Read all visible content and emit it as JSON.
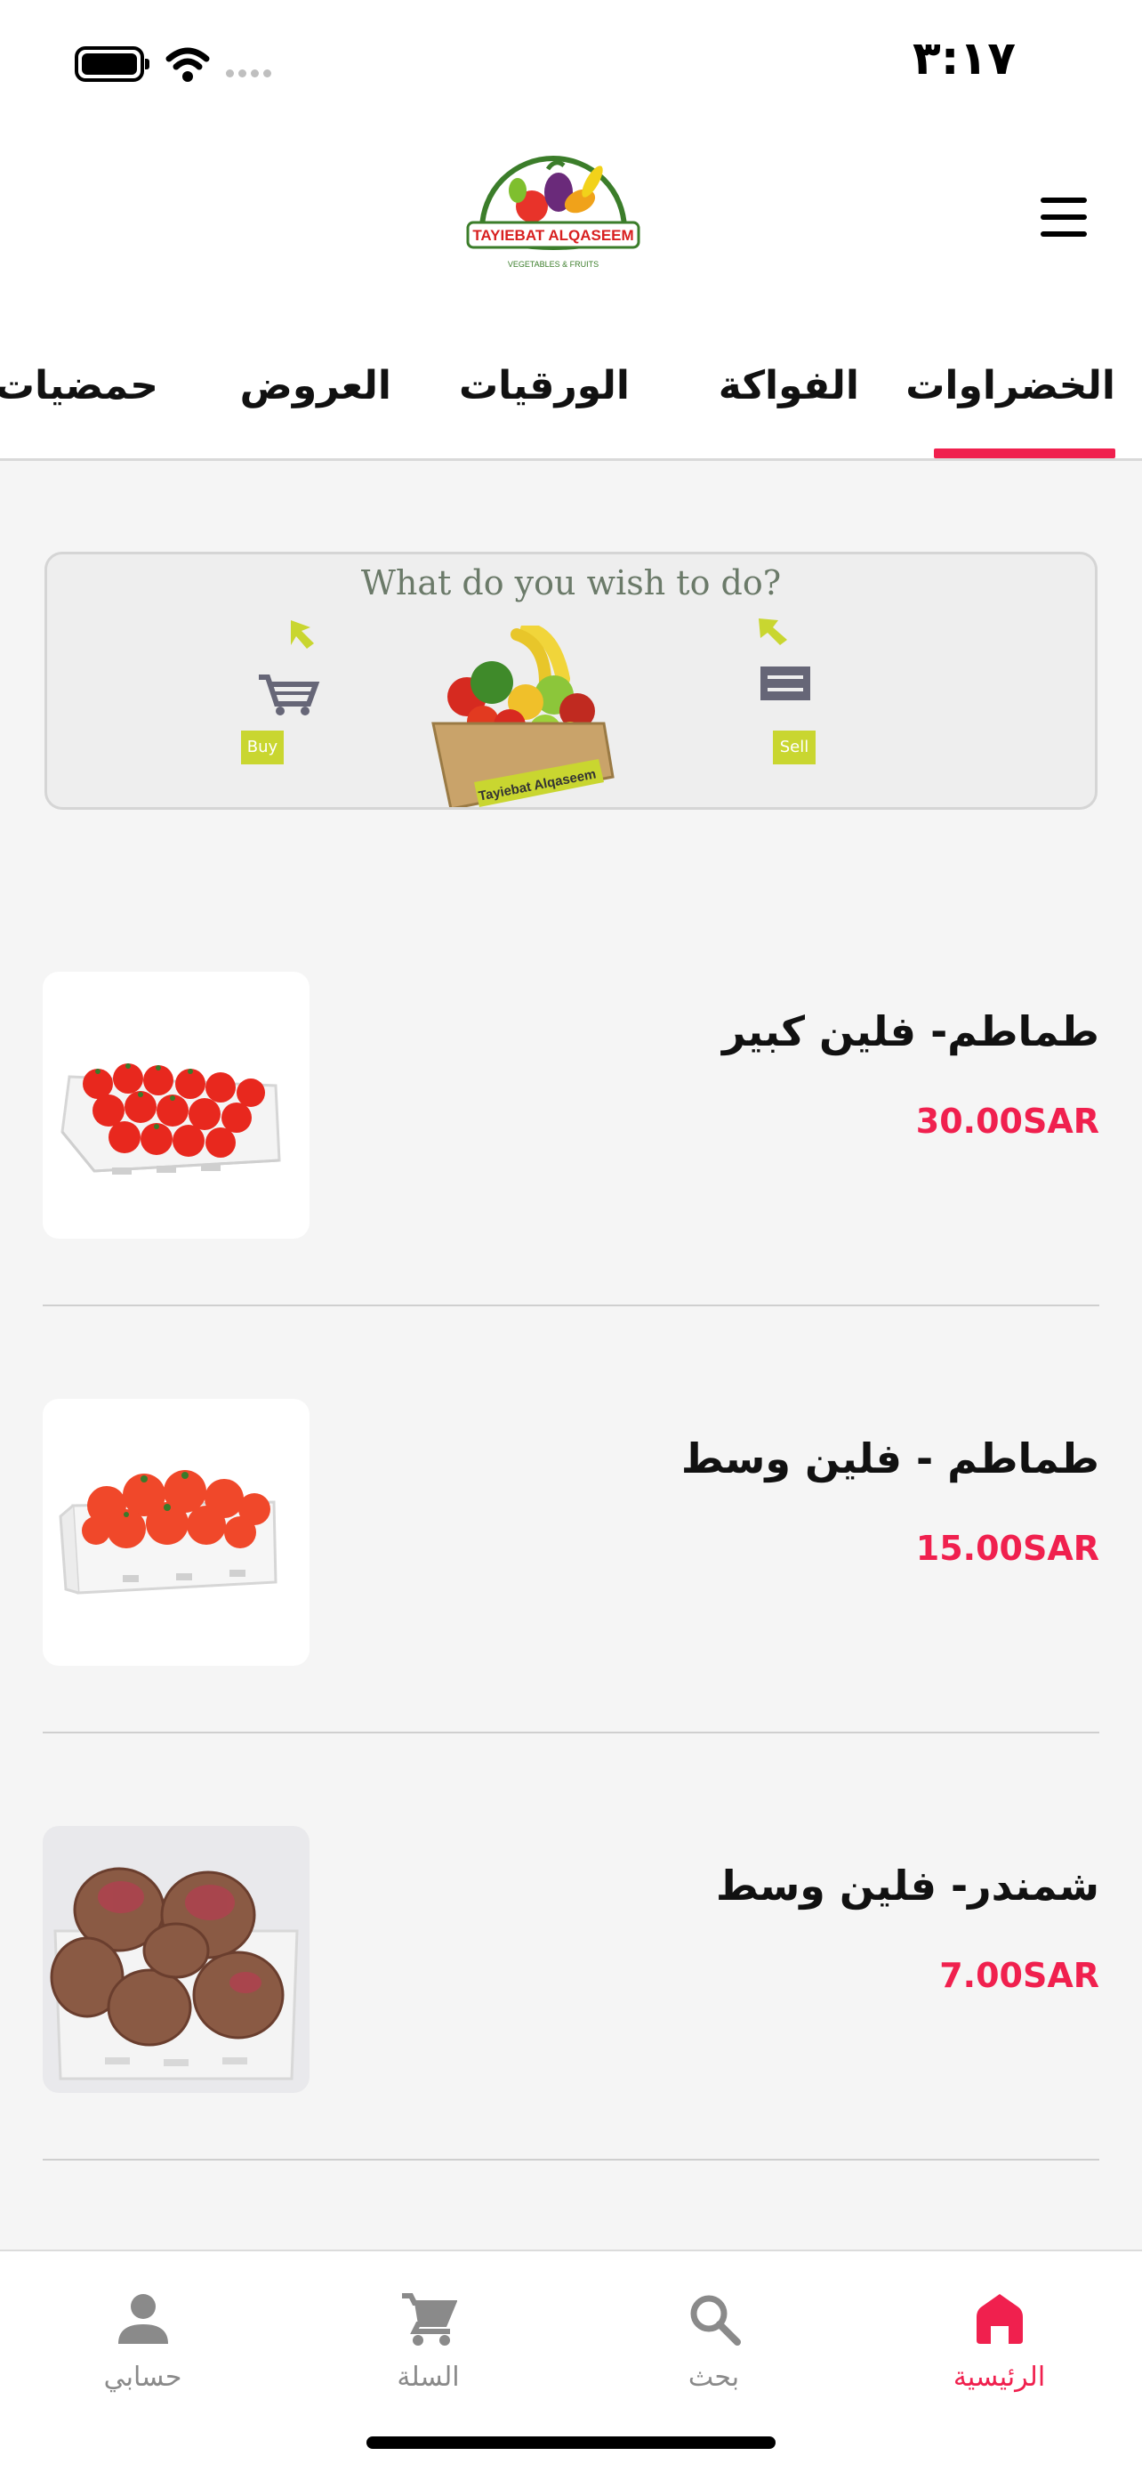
{
  "status_bar": {
    "time": "٣:١٧"
  },
  "header": {
    "logo_text": "TAYIEBAT ALQASEEM",
    "logo_subtext": "VEGETABLES & FRUITS",
    "menu_icon": "hamburger-menu-icon"
  },
  "tabs": [
    {
      "label": "الخضراوات",
      "active": true
    },
    {
      "label": "الفواكة",
      "active": false
    },
    {
      "label": "الورقيات",
      "active": false
    },
    {
      "label": "العروض",
      "active": false
    },
    {
      "label": "حمضيات",
      "active": false
    }
  ],
  "banner": {
    "title": "What do you wish to do?",
    "buy_label": "Buy",
    "sell_label": "Sell",
    "crate_label": "Tayiebat Alqaseem"
  },
  "products": [
    {
      "name": "طماطم- فلين كبير",
      "price": "30.00SAR",
      "image": "tomatoes-large-crate"
    },
    {
      "name": "طماطم - فلين وسط",
      "price": "15.00SAR",
      "image": "tomatoes-medium-crate"
    },
    {
      "name": "شمندر- فلين وسط",
      "price": "7.00SAR",
      "image": "beetroot-medium-crate"
    }
  ],
  "bottom_nav": [
    {
      "label": "الرئيسية",
      "icon": "home-icon",
      "active": true
    },
    {
      "label": "بحث",
      "icon": "search-icon",
      "active": false
    },
    {
      "label": "السلة",
      "icon": "cart-icon",
      "active": false
    },
    {
      "label": "حسابي",
      "icon": "person-icon",
      "active": false
    }
  ],
  "colors": {
    "accent": "#f0204e",
    "nav_inactive": "#8a8a8a",
    "background": "#f5f5f5"
  }
}
